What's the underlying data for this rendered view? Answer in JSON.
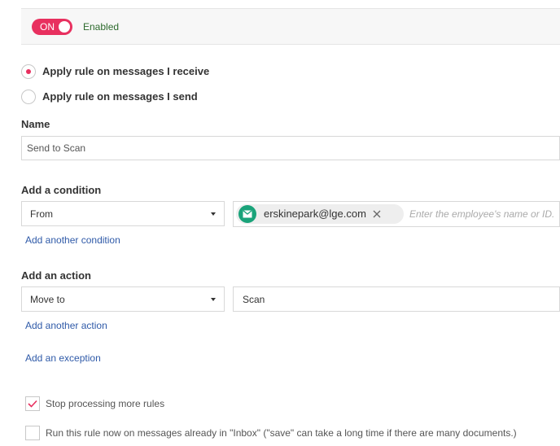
{
  "status": {
    "toggle_label": "ON",
    "text": "Enabled"
  },
  "direction": {
    "options": [
      {
        "label": "Apply rule on messages I receive",
        "selected": true
      },
      {
        "label": "Apply rule on messages I send",
        "selected": false
      }
    ]
  },
  "name": {
    "label": "Name",
    "value": "Send to Scan"
  },
  "condition": {
    "label": "Add a condition",
    "field": "From",
    "recipient": "erskinepark@lge.com",
    "placeholder": "Enter the employee's name or ID.",
    "add_link": "Add another condition"
  },
  "action": {
    "label": "Add an action",
    "type": "Move to",
    "folder": "Scan",
    "add_link": "Add another action"
  },
  "exception": {
    "link": "Add an exception"
  },
  "options": {
    "stop": {
      "label": "Stop processing more rules",
      "checked": true
    },
    "run_now": {
      "label": "Run this rule now on messages already in \"Inbox\" (\"save\" can take a long time if there are many documents.)",
      "checked": false
    }
  },
  "colors": {
    "accent": "#e8305f",
    "link": "#2f5aa8",
    "enabled_text": "#2e6b2e",
    "chip_icon": "#1aa37a"
  },
  "icons": {
    "chip": "mail-icon",
    "remove": "close-icon",
    "dropdown": "caret-down-icon",
    "check": "check-icon"
  }
}
